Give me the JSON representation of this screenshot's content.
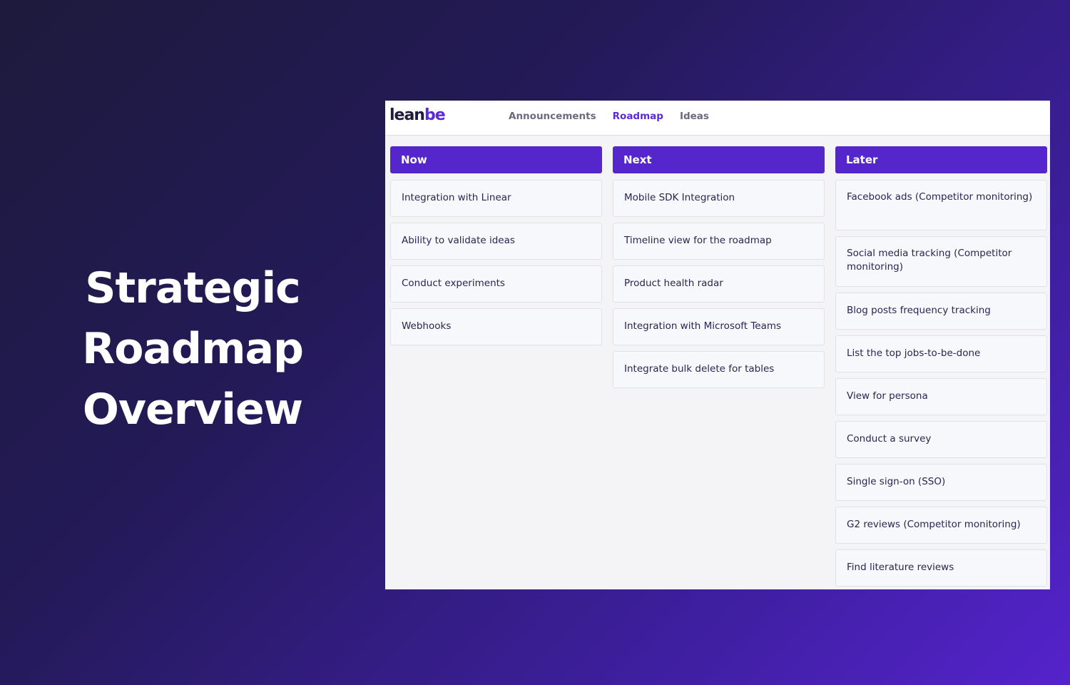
{
  "hero": {
    "lines": [
      "Strategic",
      "Roadmap",
      "Overview"
    ]
  },
  "app": {
    "logo": {
      "prefix": "lean",
      "suffix": "be"
    },
    "nav": [
      {
        "label": "Announcements",
        "active": false
      },
      {
        "label": "Roadmap",
        "active": true
      },
      {
        "label": "Ideas",
        "active": false
      }
    ],
    "colors": {
      "accent": "#5426cc",
      "header_text": "#ffffff",
      "card_bg": "#f7f8fc"
    },
    "columns": [
      {
        "title": "Now",
        "items": [
          "Integration with Linear",
          "Ability to validate ideas",
          "Conduct experiments",
          "Webhooks"
        ]
      },
      {
        "title": "Next",
        "items": [
          "Mobile SDK Integration",
          "Timeline view for the roadmap",
          "Product health radar",
          "Integration with Microsoft Teams",
          "Integrate bulk delete for tables"
        ]
      },
      {
        "title": "Later",
        "items": [
          "Facebook ads (Competitor monitoring)",
          "Social media tracking (Competitor monitoring)",
          "Blog posts frequency tracking",
          "List the top jobs-to-be-done",
          "View for persona",
          "Conduct a survey",
          "Single sign-on (SSO)",
          "G2 reviews (Competitor monitoring)",
          "Find literature reviews"
        ]
      }
    ]
  }
}
